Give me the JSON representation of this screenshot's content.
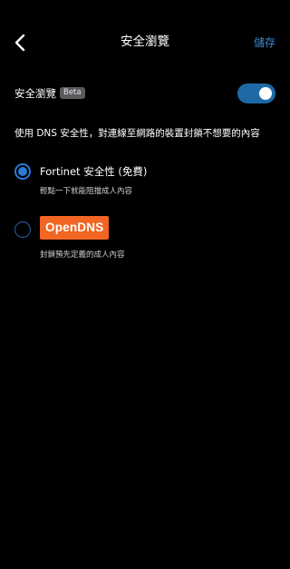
{
  "header": {
    "title": "安全瀏覽",
    "back_icon": "chevron-left-icon",
    "save_label": "儲存"
  },
  "safe_browsing": {
    "label": "安全瀏覽",
    "badge": "Beta",
    "enabled": true
  },
  "description": "使用 DNS 安全性，對連線至網路的裝置封鎖不想要的內容",
  "options": [
    {
      "title": "Fortinet 安全性 (免費)",
      "subtitle": "輕點一下就能阻擋成人內容",
      "selected": true
    },
    {
      "logo_text": "OpenDNS",
      "subtitle": "封鎖預先定義的成人內容",
      "selected": false
    }
  ],
  "colors": {
    "background": "#000000",
    "accent": "#2a78d8",
    "save": "#3d8bd6",
    "switch_on": "#1d6aa6",
    "opendns_brand": "#f26522"
  }
}
